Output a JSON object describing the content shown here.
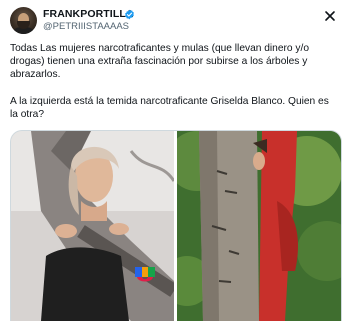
{
  "tweet": {
    "author_name": "FRANKPORTILLA",
    "author_handle": "@PETRIIISTAAAAS",
    "paragraphs": [
      "Todas Las mujeres narcotraficantes y mulas (que llevan dinero y/o drogas)  tienen una extraña fascinación  por subirse a los árboles y abrazarlos.",
      "A la izquierda está la temida narcotraficante  Griselda Blanco. Quien es la otra?"
    ]
  },
  "icons": {
    "verified": "verified-badge-icon",
    "close": "close-icon",
    "watermark": "univision-logo-icon"
  },
  "colors": {
    "text": "#0f1419",
    "muted": "#536471",
    "verified": "#1d9bf0",
    "border": "#cfd9de"
  }
}
